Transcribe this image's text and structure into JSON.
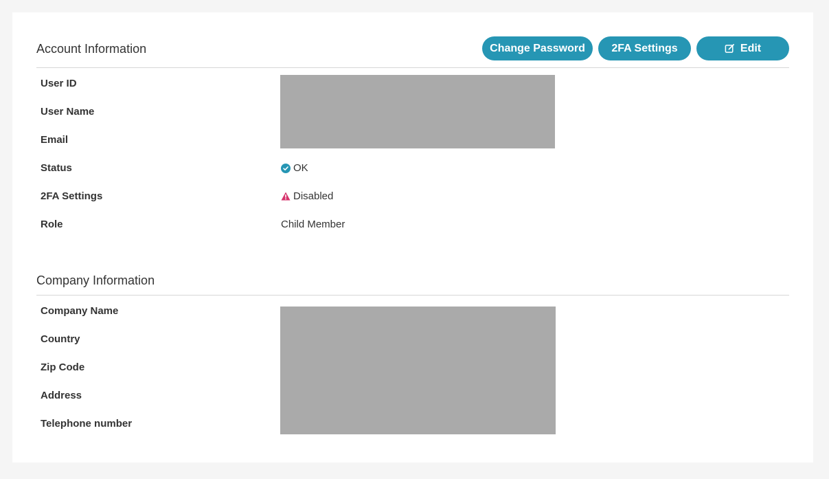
{
  "account": {
    "title": "Account Information",
    "buttons": {
      "change_password": "Change Password",
      "twofa_settings": "2FA Settings",
      "edit": "Edit"
    },
    "rows": [
      {
        "label": "User ID",
        "value": ""
      },
      {
        "label": "User Name",
        "value": ""
      },
      {
        "label": "Email",
        "value": ""
      },
      {
        "label": "Status",
        "value": "OK",
        "icon": "check-circle-icon"
      },
      {
        "label": "2FA Settings",
        "value": "Disabled",
        "icon": "warning-triangle-icon"
      },
      {
        "label": "Role",
        "value": "Child Member"
      }
    ]
  },
  "company": {
    "title": "Company Information",
    "rows": [
      {
        "label": "Company Name",
        "value": ""
      },
      {
        "label": "Country",
        "value": ""
      },
      {
        "label": "Zip Code",
        "value": ""
      },
      {
        "label": "Address",
        "value": ""
      },
      {
        "label": "Telephone number",
        "value": ""
      }
    ]
  },
  "colors": {
    "accent": "#2696b4",
    "warning": "#d6336c",
    "redacted": "#aaaaaa",
    "background": "#f5f5f5"
  }
}
